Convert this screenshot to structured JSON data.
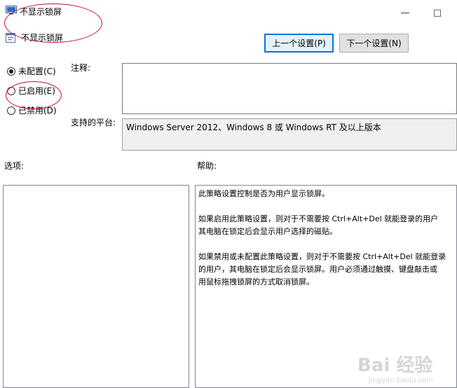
{
  "window": {
    "title": "不显示锁屏",
    "maximize_glyph": "□",
    "minimize_glyph": "—"
  },
  "header": {
    "policy_name": "不显示锁屏",
    "prev_button": "上一个设置(P)",
    "next_button": "下一个设置(N)"
  },
  "state": {
    "options": [
      {
        "label": "未配置(C)",
        "checked": true
      },
      {
        "label": "已启用(E)",
        "checked": false
      },
      {
        "label": "已禁用(D)",
        "checked": false
      }
    ]
  },
  "comment": {
    "label": "注释:",
    "value": ""
  },
  "platform": {
    "label": "支持的平台:",
    "value": "Windows Server 2012、Windows 8 或 Windows RT 及以上版本"
  },
  "options_panel": {
    "label": "选项:"
  },
  "help_panel": {
    "label": "帮助:",
    "paragraphs": [
      [
        "此策略设置控制是否为用户显示锁屏。"
      ],
      [
        "如果启用此策略设置，则对于不需要按 Ctrl+Alt+Del 就能登录的用户",
        "其电脑在锁定后会显示用户选择的磁贴。"
      ],
      [
        "如果禁用或未配置此策略设置，则对于不需要按 Ctrl+Alt+Del 就能登录",
        "的用户，其电脑在锁定后会显示锁屏。用户必须通过触摸、键盘敲击或",
        "用鼠标拖拽锁屏的方式取消锁屏。"
      ]
    ]
  },
  "colors": {
    "annotation": "#c8102e",
    "primary_button_border": "#0078d7",
    "platform_box_bg": "#f0f0f0"
  },
  "watermark": {
    "text": "Bai 经验",
    "url": "jingyan.baidu.com"
  }
}
